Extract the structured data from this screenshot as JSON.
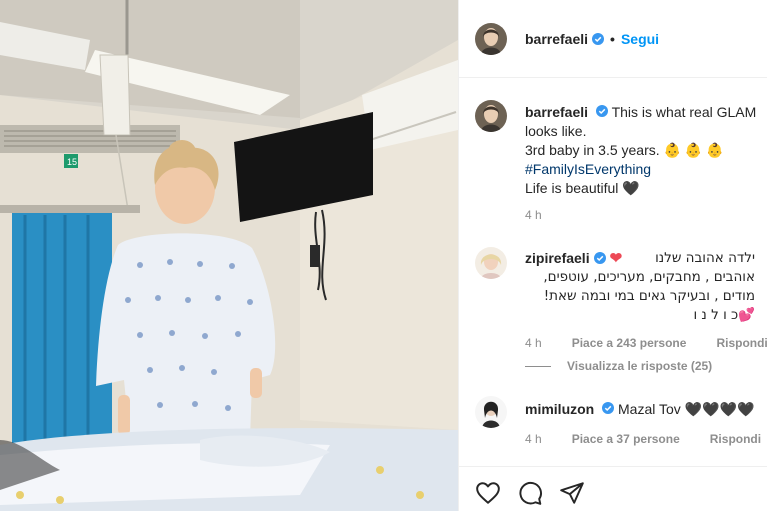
{
  "post": {
    "username": "barrefaeli",
    "follow_label": "Segui",
    "dot": "•",
    "caption": {
      "line1": "This is what real GLAM",
      "line2": "looks like.",
      "line3": "3rd baby in 3.5 years. 👶 👶 👶",
      "hashtag": "#FamilyIsEverything",
      "line5": "Life is beautiful 🖤"
    },
    "time": "4 h"
  },
  "comments": [
    {
      "username": "zipirefaeli",
      "text_lines": [
        "ילדה אהובה שלנו",
        "אוהבים , מחבקים, מעריכים, עוטפים,",
        "מודים , ובעיקר גאים במי ובמה שאת!",
        "כ ו ל נ ו"
      ],
      "time": "4 h",
      "likes": "Piace a 243 persone",
      "reply": "Rispondi",
      "view_replies": "Visualizza le risposte (25)"
    },
    {
      "username": "mimiluzon",
      "text": "Mazal Tov 🖤🖤🖤🖤",
      "time": "4 h",
      "likes": "Piace a 37 persone",
      "reply": "Rispondi"
    }
  ],
  "photo": {
    "wall_sign": "15"
  },
  "icons": [
    "heart-icon",
    "comment-icon",
    "share-icon",
    "verified-icon"
  ],
  "colors": {
    "accent": "#0095f6",
    "hashtag": "#00376b",
    "muted": "#8e8e8e",
    "curtain": "#2a8fc4"
  }
}
